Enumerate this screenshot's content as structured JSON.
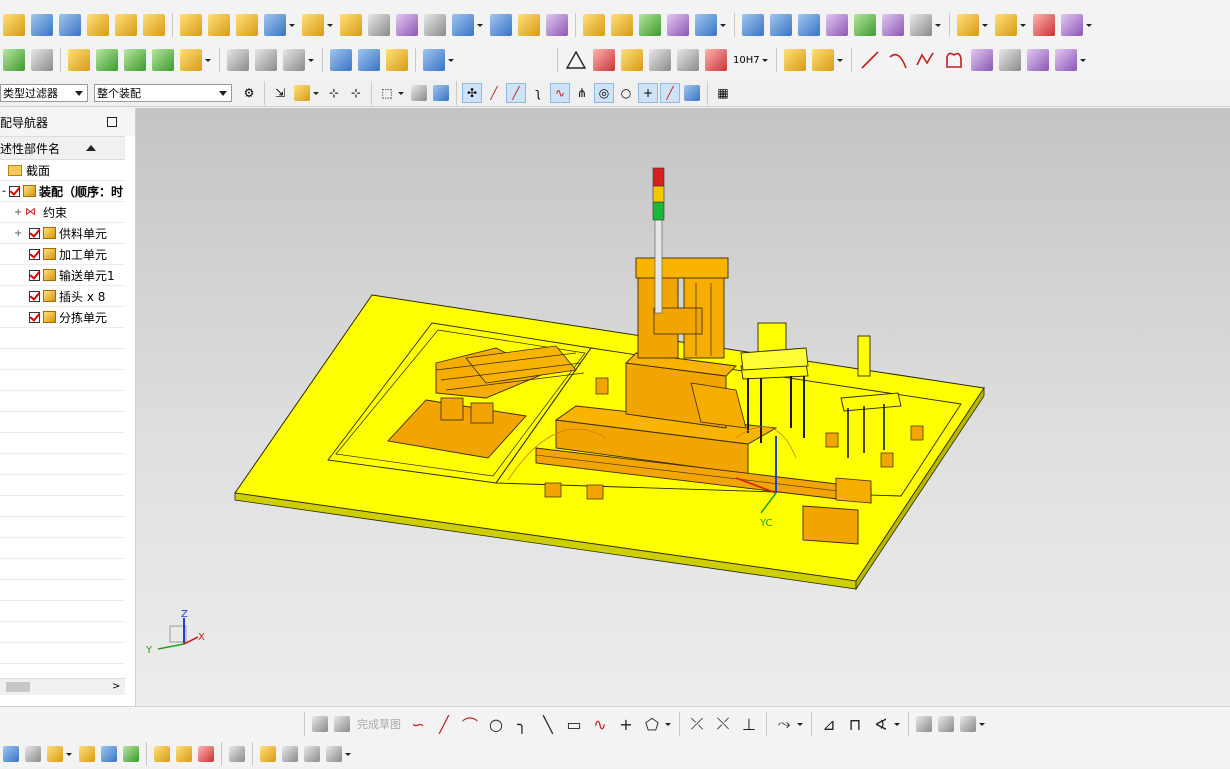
{
  "filters": {
    "type_filter": "类型过滤器",
    "scope": "整个装配"
  },
  "navigator": {
    "title": "装配导航器",
    "column_header": "描述性部件名",
    "items": [
      {
        "label": "截面",
        "kind": "folder",
        "indent": 0
      },
      {
        "label": "装配（顺序：时",
        "kind": "assembly",
        "indent": 0,
        "bold": true
      },
      {
        "label": "约束",
        "kind": "constraint",
        "indent": 1
      },
      {
        "label": "供料单元",
        "kind": "subassembly",
        "indent": 1
      },
      {
        "label": "加工单元",
        "kind": "part",
        "indent": 1
      },
      {
        "label": "输送单元1",
        "kind": "part",
        "indent": 1
      },
      {
        "label": "插头 x 8",
        "kind": "part",
        "indent": 1
      },
      {
        "label": "分拣单元",
        "kind": "part",
        "indent": 1
      }
    ]
  },
  "toolbar": {
    "measure_label": "10H7"
  },
  "sketch_bar": {
    "finish_label": "完成草图"
  },
  "triad": {
    "x": "X",
    "y": "Y",
    "z": "Z",
    "yc": "YC"
  },
  "colors": {
    "base_yellow": "#ffff00",
    "part_orange": "#f2a500",
    "edge": "#2a2a00"
  }
}
